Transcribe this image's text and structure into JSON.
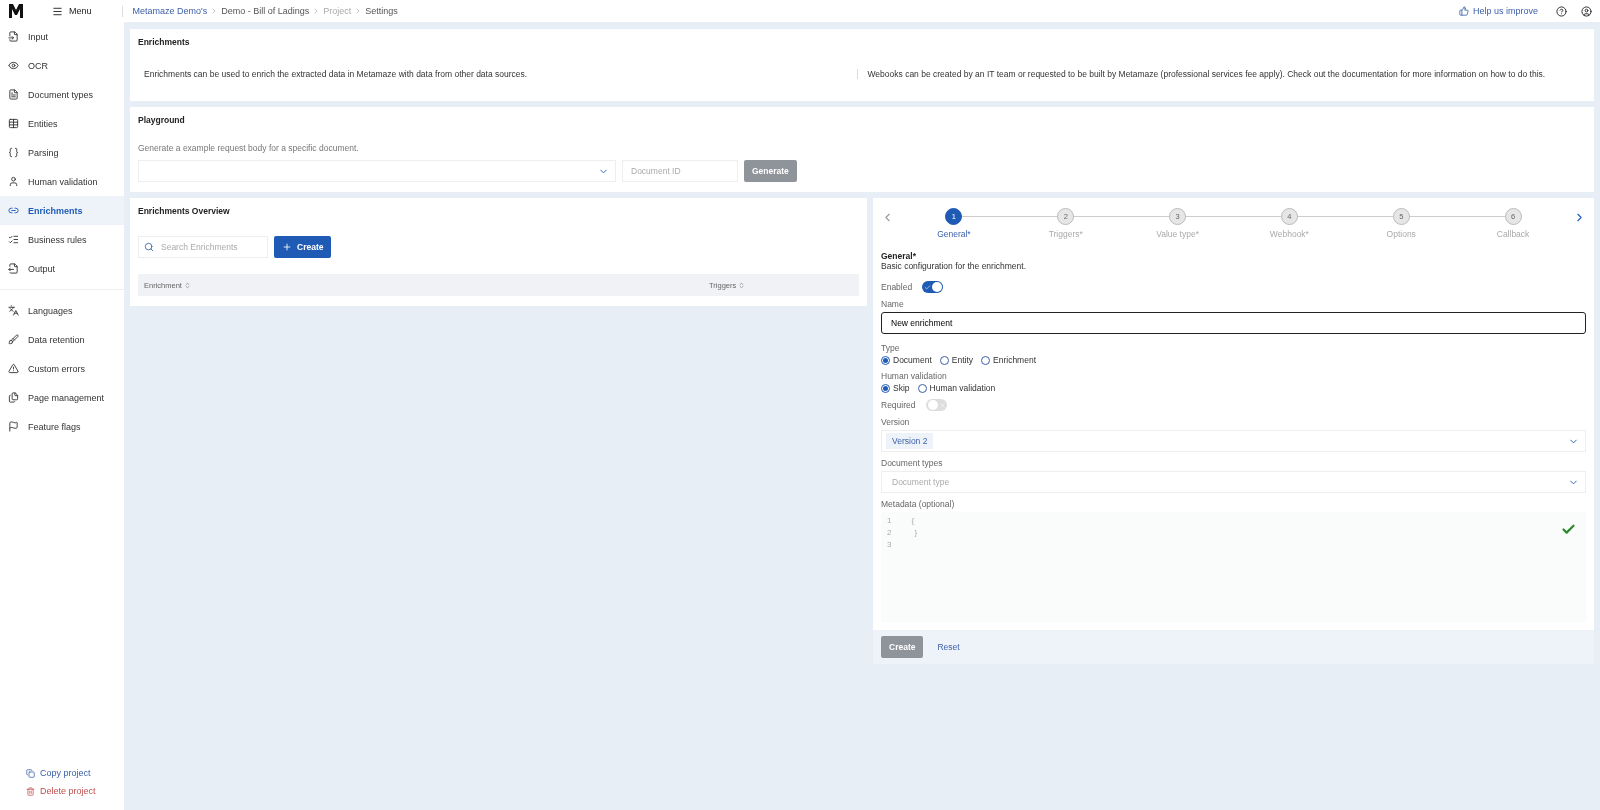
{
  "topbar": {
    "menu_label": "Menu",
    "breadcrumbs": [
      {
        "label": "Metamaze Demo's",
        "kind": "link"
      },
      {
        "label": "Demo - Bill of Ladings",
        "kind": "text"
      },
      {
        "label": "Project",
        "kind": "muted"
      },
      {
        "label": "Settings",
        "kind": "text"
      }
    ],
    "help_label": "Help us improve"
  },
  "sidebar": {
    "groups": [
      [
        {
          "label": "Input",
          "selected": false
        },
        {
          "label": "OCR",
          "selected": false
        },
        {
          "label": "Document types",
          "selected": false
        },
        {
          "label": "Entities",
          "selected": false
        },
        {
          "label": "Parsing",
          "selected": false
        },
        {
          "label": "Human validation",
          "selected": false
        },
        {
          "label": "Enrichments",
          "selected": true
        },
        {
          "label": "Business rules",
          "selected": false
        },
        {
          "label": "Output",
          "selected": false
        }
      ],
      [
        {
          "label": "Languages",
          "selected": false
        },
        {
          "label": "Data retention",
          "selected": false
        },
        {
          "label": "Custom errors",
          "selected": false
        },
        {
          "label": "Page management",
          "selected": false
        },
        {
          "label": "Feature flags",
          "selected": false
        }
      ]
    ],
    "actions": [
      {
        "label": "Copy project",
        "kind": "copy"
      },
      {
        "label": "Delete project",
        "kind": "delete"
      }
    ]
  },
  "info": {
    "title": "Enrichments",
    "texts": [
      "Enrichments can be used to enrich the extracted data in Metamaze with data from other data sources.",
      "Webooks can be created by an IT team or requested to be built by Metamaze (professional services fee apply). Check out the documentation for more information on how to do this."
    ]
  },
  "playground": {
    "title": "Playground",
    "description": "Generate a example request body for a specific document.",
    "document_id_placeholder": "Document ID",
    "generate": {
      "label": "Generate",
      "disabled": true
    }
  },
  "overview": {
    "title": "Enrichments Overview",
    "search_placeholder": "Search Enrichments",
    "create_label": "Create",
    "columns": [
      "Enrichment",
      "Triggers"
    ]
  },
  "wizard": {
    "steps": [
      {
        "number": "1",
        "label": "General*",
        "selected": true
      },
      {
        "number": "2",
        "label": "Triggers*",
        "selected": false
      },
      {
        "number": "3",
        "label": "Value type*",
        "selected": false
      },
      {
        "number": "4",
        "label": "Webhook*",
        "selected": false
      },
      {
        "number": "5",
        "label": "Options",
        "selected": false
      },
      {
        "number": "6",
        "label": "Callback",
        "selected": false
      }
    ],
    "section_title": "General*",
    "section_description": "Basic configuration for the enrichment.",
    "enabled": {
      "label": "Enabled",
      "on": true
    },
    "name": {
      "label": "Name",
      "value": "New enrichment"
    },
    "type": {
      "label": "Type",
      "options": [
        {
          "label": "Document",
          "selected": true
        },
        {
          "label": "Entity",
          "selected": false
        },
        {
          "label": "Enrichment",
          "selected": false
        }
      ]
    },
    "human_validation": {
      "label": "Human validation",
      "options": [
        {
          "label": "Skip",
          "selected": true
        },
        {
          "label": "Human validation",
          "selected": false
        }
      ]
    },
    "required": {
      "label": "Required",
      "on": false
    },
    "version": {
      "label": "Version",
      "value": "Version 2"
    },
    "document_types": {
      "label": "Document types",
      "placeholder": "Document type"
    },
    "metadata": {
      "label": "Metadata (optional)",
      "lines": [
        {
          "number": "1",
          "code": "{"
        },
        {
          "number": "2",
          "code": "}"
        },
        {
          "number": "3"
        }
      ]
    },
    "footer": {
      "create": {
        "label": "Create",
        "disabled": true
      },
      "reset_label": "Reset"
    }
  }
}
